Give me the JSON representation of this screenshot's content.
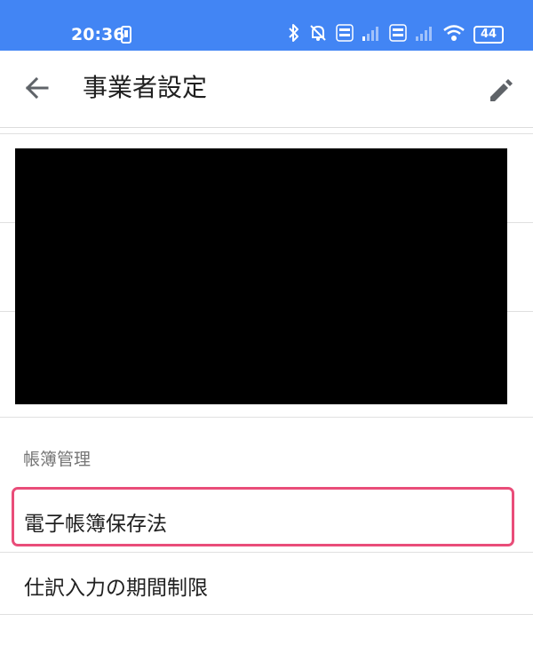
{
  "status_bar": {
    "time": "20:36",
    "battery": "44",
    "icons": [
      "phone-icon",
      "bluetooth-icon",
      "mute-icon",
      "volte-icon",
      "signal-icon",
      "volte-icon",
      "signal-icon",
      "wifi-icon",
      "battery-icon"
    ]
  },
  "header": {
    "title": "事業者設定",
    "back_icon": "back-arrow-icon",
    "edit_icon": "edit-icon"
  },
  "section": {
    "title": "帳簿管理"
  },
  "items": [
    {
      "label": "電子帳簿保存法"
    },
    {
      "label": "仕訳入力の期間制限"
    }
  ],
  "colors": {
    "status_bar": "#4285f4",
    "highlight": "#e94d79",
    "section_text": "#757575",
    "text": "#202020"
  }
}
